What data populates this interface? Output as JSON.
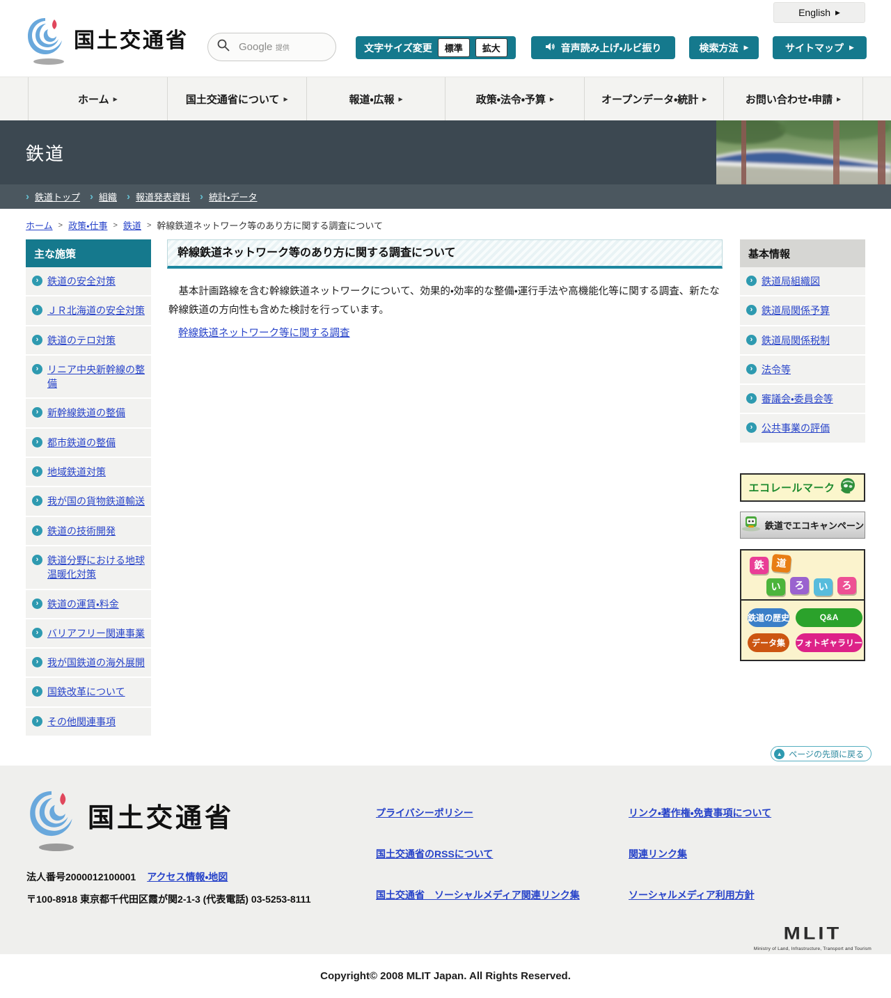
{
  "icons": {
    "arrow_right": "▶",
    "chevron": "›",
    "breadcrumb_sep": ">",
    "up_arrow": "▲"
  },
  "colors": {
    "teal": "#15798d",
    "heading_border": "#1d87a0",
    "link_blue": "#2743c9",
    "hero_bg": "#3c4851",
    "subband_bg": "#4b575f",
    "nav_bg": "#f3f3f1",
    "iroiro_buttons": {
      "history": "#3b7fc8",
      "qa": "#2ba22b",
      "data": "#cc5511",
      "photo": "#dd2288"
    }
  },
  "header": {
    "english_label": "English",
    "logo_text": "国土交通省",
    "search_provider": "Google",
    "search_provider_suffix": "提供",
    "fontsize_label": "文字サイズ変更",
    "fontsize_standard": "標準",
    "fontsize_large": "拡大",
    "audio_label": "音声読み上げ・ルビ振り",
    "search_method_label": "検索方法",
    "sitemap_label": "サイトマップ"
  },
  "nav": {
    "items": [
      {
        "label": "ホーム"
      },
      {
        "label": "国土交通省について"
      },
      {
        "label": "報道・広報"
      },
      {
        "label": "政策・法令・予算"
      },
      {
        "label": "オープンデータ・統計"
      },
      {
        "label": "お問い合わせ・申請"
      }
    ]
  },
  "hero": {
    "title": "鉄道",
    "links": [
      {
        "label": "鉄道トップ"
      },
      {
        "label": "組織"
      },
      {
        "label": "報道発表資料"
      },
      {
        "label": "統計・データ"
      }
    ]
  },
  "breadcrumb": {
    "links": [
      {
        "label": "ホーム"
      },
      {
        "label": "政策・仕事"
      },
      {
        "label": "鉄道"
      }
    ],
    "current": "幹線鉄道ネットワーク等のあり方に関する調査について"
  },
  "sidebar": {
    "title": "主な施策",
    "items": [
      {
        "label": "鉄道の安全対策"
      },
      {
        "label": "ＪＲ北海道の安全対策"
      },
      {
        "label": "鉄道のテロ対策"
      },
      {
        "label": "リニア中央新幹線の整備"
      },
      {
        "label": "新幹線鉄道の整備"
      },
      {
        "label": "都市鉄道の整備"
      },
      {
        "label": "地域鉄道対策"
      },
      {
        "label": "我が国の貨物鉄道輸送"
      },
      {
        "label": "鉄道の技術開発"
      },
      {
        "label": "鉄道分野における地球温暖化対策"
      },
      {
        "label": "鉄道の運賃・料金"
      },
      {
        "label": "バリアフリー関連事業"
      },
      {
        "label": "我が国鉄道の海外展開"
      },
      {
        "label": "国鉄改革について"
      },
      {
        "label": "その他関連事項"
      }
    ]
  },
  "main": {
    "title": "幹線鉄道ネットワーク等のあり方に関する調査について",
    "paragraph": "　基本計画路線を含む幹線鉄道ネットワークについて、効果的・効率的な整備・運行手法や高機能化等に関する調査、新たな幹線鉄道の方向性も含めた検討を行っています。",
    "link": "幹線鉄道ネットワーク等に関する調査"
  },
  "info": {
    "title": "基本情報",
    "items": [
      {
        "label": "鉄道局組織図"
      },
      {
        "label": "鉄道局関係予算"
      },
      {
        "label": "鉄道局関係税制"
      },
      {
        "label": "法令等"
      },
      {
        "label": "審議会・委員会等"
      },
      {
        "label": "公共事業の評価"
      }
    ]
  },
  "banners": {
    "ecorail_label": "エコレールマーク",
    "campaign_label": "鉄道でエコキャンペーン",
    "iroiro": {
      "chars": [
        "鉄",
        "道",
        "い",
        "ろ",
        "い",
        "ろ"
      ],
      "buttons": [
        {
          "label": "鉄道の歴史"
        },
        {
          "label": "Q&A"
        },
        {
          "label": "データ集"
        },
        {
          "label": "フォトギャラリー"
        }
      ]
    }
  },
  "back_to_top": "ページの先頭に戻る",
  "footer": {
    "logo_text": "国土交通省",
    "corporate_number": "法人番号2000012100001",
    "access_link": "アクセス情報・地図",
    "address": "〒100-8918 東京都千代田区霞が関2-1-3 (代表電話) 03-5253-8111",
    "links": {
      "col1": [
        "プライバシーポリシー",
        "国土交通省のRSSについて",
        "国土交通省　ソーシャルメディア関連リンク集"
      ],
      "col2": [
        "リンク・著作権・免責事項について",
        "関連リンク集",
        "ソーシャルメディア利用方針"
      ]
    },
    "mlit_word": "MLIT",
    "mlit_caption": "Ministry of Land, Infrastructure, Transport and Tourism"
  },
  "copyright": "Copyright© 2008 MLIT Japan. All Rights Reserved."
}
